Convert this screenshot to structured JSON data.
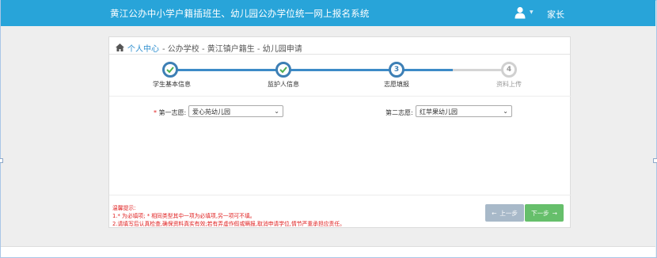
{
  "header": {
    "title": "黄江公办中小学户籍插班生、幼儿园公办学位统一网上报名系统",
    "user_name": "家长",
    "user_icon": "user-icon"
  },
  "breadcrumb": {
    "home_icon": "home-icon",
    "link_label": "个人中心",
    "trail": "- 公办学校 - 黄江镇户籍生 - 幼儿园申请"
  },
  "steps": [
    {
      "label": "学生基本信息",
      "state": "done",
      "number": ""
    },
    {
      "label": "监护人信息",
      "state": "done",
      "number": ""
    },
    {
      "label": "志愿填报",
      "state": "active",
      "number": "3"
    },
    {
      "label": "资料上传",
      "state": "todo",
      "number": "4"
    }
  ],
  "form": {
    "first_choice": {
      "label": "第一志愿:",
      "required_mark": "*",
      "value": "爱心苑幼儿园"
    },
    "second_choice": {
      "label": "第二志愿:",
      "value": "红苹果幼儿园"
    }
  },
  "notes": {
    "title": "温馨提示:",
    "line1_prefix": "1.* 为必填项;",
    "line1_rest": "* 相同类型其中一项为必填项,另一项可不填。",
    "line2": "2.请填写后认真检查,确保资料真实有效;若有弄虚作假或瞒报,取消申请学位,情节严重承担应责任。"
  },
  "buttons": {
    "prev_label": "上一步",
    "next_label": "下一步"
  },
  "colors": {
    "header_bg": "#28a4d9",
    "step_active": "#3d7fb5",
    "next_btn": "#66bf6b",
    "prev_btn": "#a8b9c9",
    "note_text": "#e02020"
  }
}
